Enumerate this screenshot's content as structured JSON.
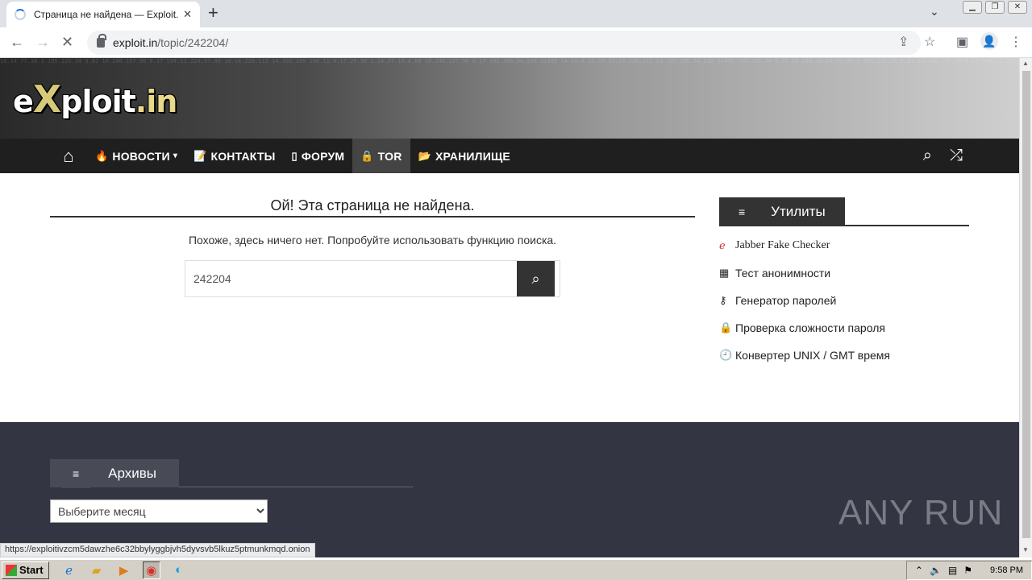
{
  "browser": {
    "tab_title": "Страница не найдена — Exploit.IN",
    "tab_close": "✕",
    "new_tab": "+",
    "url_host": "exploit.in",
    "url_path": "/topic/242204/"
  },
  "site": {
    "logo_e": "e",
    "logo_x": "X",
    "logo_ploit": "ploit",
    "logo_dot_in": ".in",
    "nav": {
      "news": "НОВОСТИ",
      "contacts": "КОНТАКТЫ",
      "forum": "ФОРУМ",
      "tor": "TOR",
      "storage": "ХРАНИЛИЩЕ"
    }
  },
  "main": {
    "error_title": "Ой! Эта страница не найдена.",
    "error_message": "Похоже, здесь ничего нет. Попробуйте использовать функцию поиска.",
    "search_value": "242204"
  },
  "sidebar": {
    "widget_title": "Утилиты",
    "items": [
      {
        "label": "Jabber Fake Checker",
        "icon": "ear-icon"
      },
      {
        "label": "Тест анонимности",
        "icon": "keypad-icon"
      },
      {
        "label": "Генератор паролей",
        "icon": "key-icon"
      },
      {
        "label": "Проверка сложности пароля",
        "icon": "lock-icon"
      },
      {
        "label": "Конвертер UNIX / GMT время",
        "icon": "clock-icon"
      }
    ]
  },
  "footer": {
    "archives_title": "Архивы",
    "month_select": "Выберите месяц",
    "watermark": "ANY RUN"
  },
  "status_url": "https://exploitivzcm5dawzhe6c32bbylyggbjvh5dyvsvb5lkuz5ptmunkmqd.onion",
  "taskbar": {
    "start": "Start",
    "clock": "9:58 PM"
  }
}
